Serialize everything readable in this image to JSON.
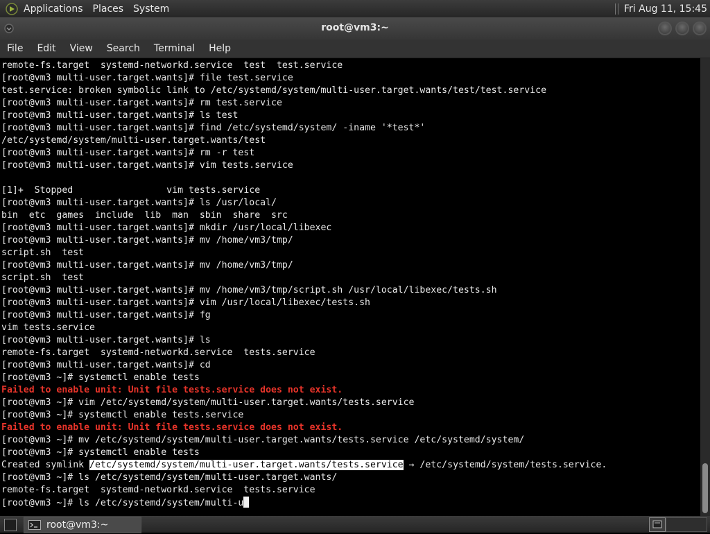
{
  "top_panel": {
    "applications": "Applications",
    "places": "Places",
    "system": "System",
    "clock": "Fri Aug 11, 15:45"
  },
  "window": {
    "title": "root@vm3:~"
  },
  "menubar": {
    "items": [
      "File",
      "Edit",
      "View",
      "Search",
      "Terminal",
      "Help"
    ]
  },
  "terminal": {
    "lines": [
      {
        "text": "remote-fs.target  systemd-networkd.service  test  test.service"
      },
      {
        "text": "[root@vm3 multi-user.target.wants]# file test.service"
      },
      {
        "text": "test.service: broken symbolic link to /etc/systemd/system/multi-user.target.wants/test/test.service"
      },
      {
        "text": "[root@vm3 multi-user.target.wants]# rm test.service"
      },
      {
        "text": "[root@vm3 multi-user.target.wants]# ls test"
      },
      {
        "text": "[root@vm3 multi-user.target.wants]# find /etc/systemd/system/ -iname '*test*'"
      },
      {
        "text": "/etc/systemd/system/multi-user.target.wants/test"
      },
      {
        "text": "[root@vm3 multi-user.target.wants]# rm -r test"
      },
      {
        "text": "[root@vm3 multi-user.target.wants]# vim tests.service"
      },
      {
        "text": ""
      },
      {
        "text": "[1]+  Stopped                 vim tests.service"
      },
      {
        "text": "[root@vm3 multi-user.target.wants]# ls /usr/local/"
      },
      {
        "text": "bin  etc  games  include  lib  man  sbin  share  src"
      },
      {
        "text": "[root@vm3 multi-user.target.wants]# mkdir /usr/local/libexec"
      },
      {
        "text": "[root@vm3 multi-user.target.wants]# mv /home/vm3/tmp/"
      },
      {
        "text": "script.sh  test"
      },
      {
        "text": "[root@vm3 multi-user.target.wants]# mv /home/vm3/tmp/"
      },
      {
        "text": "script.sh  test"
      },
      {
        "text": "[root@vm3 multi-user.target.wants]# mv /home/vm3/tmp/script.sh /usr/local/libexec/tests.sh"
      },
      {
        "text": "[root@vm3 multi-user.target.wants]# vim /usr/local/libexec/tests.sh"
      },
      {
        "text": "[root@vm3 multi-user.target.wants]# fg"
      },
      {
        "text": "vim tests.service"
      },
      {
        "text": "[root@vm3 multi-user.target.wants]# ls"
      },
      {
        "text": "remote-fs.target  systemd-networkd.service  tests.service"
      },
      {
        "text": "[root@vm3 multi-user.target.wants]# cd"
      },
      {
        "text": "[root@vm3 ~]# systemctl enable tests"
      },
      {
        "text": "Failed to enable unit: Unit file tests.service does not exist.",
        "error": true
      },
      {
        "text": "[root@vm3 ~]# vim /etc/systemd/system/multi-user.target.wants/tests.service"
      },
      {
        "text": "[root@vm3 ~]# systemctl enable tests.service"
      },
      {
        "text": "Failed to enable unit: Unit file tests.service does not exist.",
        "error": true
      },
      {
        "text": "[root@vm3 ~]# mv /etc/systemd/system/multi-user.target.wants/tests.service /etc/systemd/system/"
      },
      {
        "text": "[root@vm3 ~]# systemctl enable tests"
      },
      {
        "text": "Created symlink ",
        "selected": "/etc/systemd/system/multi-user.target.wants/tests.service",
        "after": " → /etc/systemd/system/tests.service."
      },
      {
        "text": "[root@vm3 ~]# ls /etc/systemd/system/multi-user.target.wants/"
      },
      {
        "text": "remote-fs.target  systemd-networkd.service  tests.service"
      },
      {
        "text": "[root@vm3 ~]# ls /etc/systemd/system/multi-u",
        "cursor": true
      }
    ]
  },
  "taskbar": {
    "task_label": "root@vm3:~"
  },
  "colors": {
    "error": "#e8342a",
    "terminal_bg": "#000000",
    "terminal_fg": "#e8e8e8"
  }
}
